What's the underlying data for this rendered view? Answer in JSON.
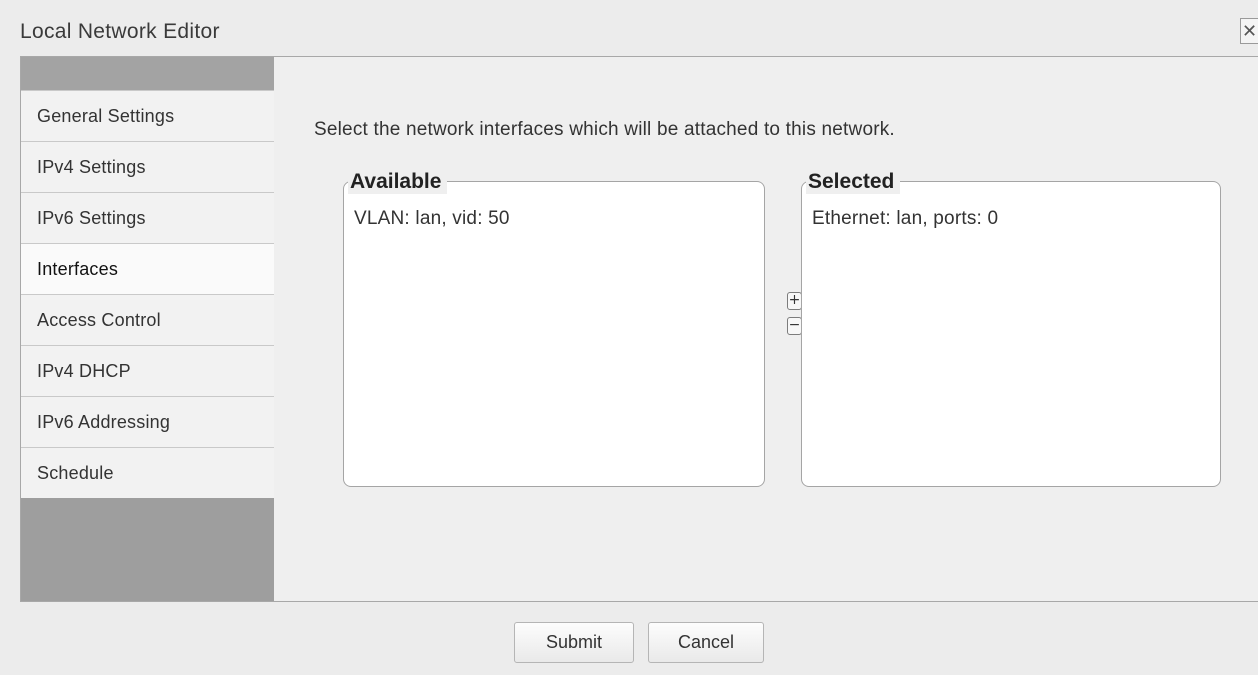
{
  "window": {
    "title": "Local Network Editor",
    "close_glyph": "✕"
  },
  "sidebar": {
    "items": [
      {
        "label": "General Settings",
        "active": false
      },
      {
        "label": "IPv4 Settings",
        "active": false
      },
      {
        "label": "IPv6 Settings",
        "active": false
      },
      {
        "label": "Interfaces",
        "active": true
      },
      {
        "label": "Access Control",
        "active": false
      },
      {
        "label": "IPv4 DHCP",
        "active": false
      },
      {
        "label": "IPv6 Addressing",
        "active": false
      },
      {
        "label": "Schedule",
        "active": false
      }
    ]
  },
  "main": {
    "instruction": "Select the network interfaces which will be attached to this network.",
    "available": {
      "legend": "Available",
      "items": [
        "VLAN: lan, vid: 50"
      ]
    },
    "selected": {
      "legend": "Selected",
      "items": [
        "Ethernet: lan, ports: 0"
      ]
    },
    "add_glyph": "+",
    "remove_glyph": "−"
  },
  "footer": {
    "submit_label": "Submit",
    "cancel_label": "Cancel"
  },
  "icons": {
    "close": "close-icon",
    "add": "plus-icon",
    "remove": "minus-icon"
  }
}
